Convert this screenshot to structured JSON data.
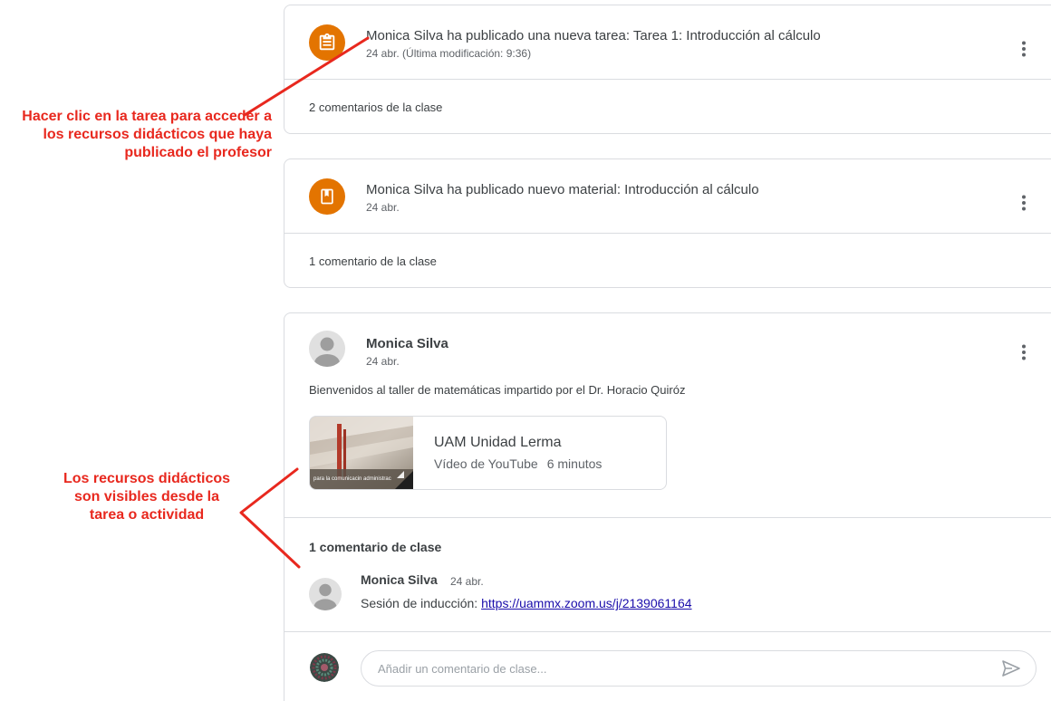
{
  "posts": [
    {
      "title": "Monica Silva ha publicado una nueva tarea: Tarea 1: Introducción al cálculo",
      "subtitle": "24 abr. (Última modificación: 9:36)",
      "comments_label": "2 comentarios de la clase",
      "icon": "assignment-icon"
    },
    {
      "title": "Monica Silva ha publicado nuevo material: Introducción al cálculo",
      "subtitle": "24 abr.",
      "comments_label": "1 comentario de la clase",
      "icon": "material-icon"
    }
  ],
  "announcement": {
    "author": "Monica Silva",
    "date": "24 abr.",
    "body": "Bienvenidos al taller de matemáticas impartido por el Dr. Horacio Quiróz",
    "attachment": {
      "title": "UAM Unidad Lerma",
      "type": "Vídeo de YouTube",
      "duration": "6 minutos",
      "thumb_caption": "para la comunicacin administrac"
    },
    "comments_header": "1 comentario de clase",
    "comment": {
      "author": "Monica Silva",
      "date": "24 abr.",
      "prefix": "Sesión de inducción: ",
      "link": "https://uammx.zoom.us/j/2139061164"
    },
    "input_placeholder": "Añadir un comentario de clase..."
  },
  "annotations": {
    "task": "Hacer clic en la tarea para acceder a los recursos didácticos que haya publicado el profesor",
    "resources": "Los recursos didácticos son visibles desde la tarea o actividad"
  },
  "colors": {
    "accent_orange": "#e37400",
    "annotation_red": "#e8281e",
    "link_blue": "#1a0dab",
    "border": "#dadce0"
  }
}
